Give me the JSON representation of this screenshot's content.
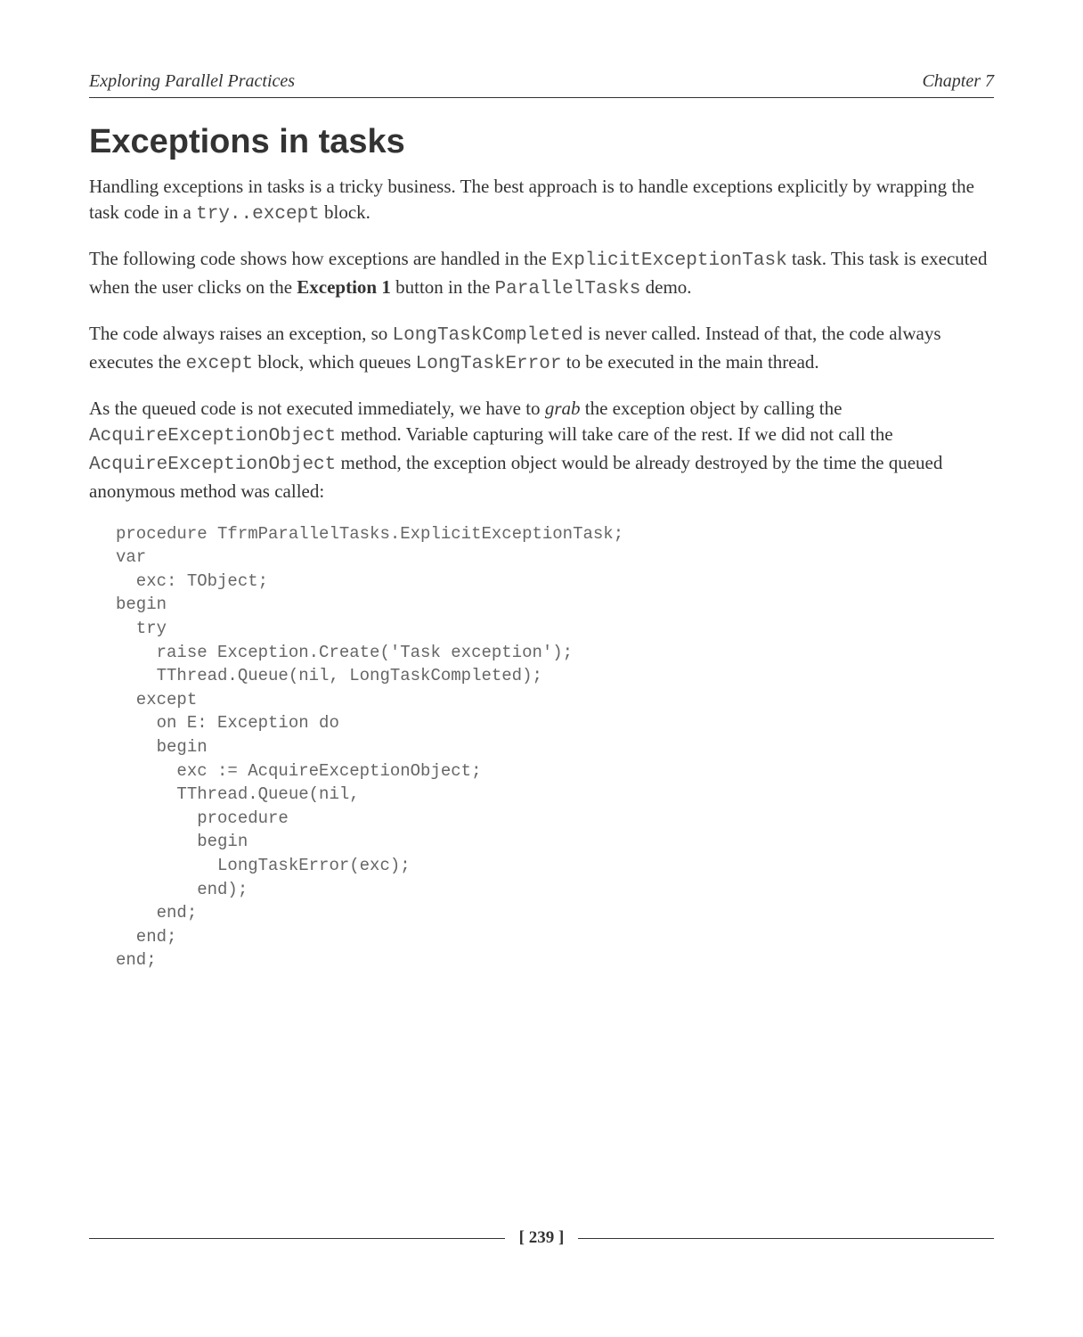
{
  "header": {
    "left": "Exploring Parallel Practices",
    "right": "Chapter 7"
  },
  "section_title": "Exceptions in tasks",
  "p1": {
    "t1": "Handling exceptions in tasks is a tricky business. The best approach is to handle exceptions explicitly by wrapping the task code in a ",
    "c1": "try..except",
    "t2": " block."
  },
  "p2": {
    "t1": "The following code shows how exceptions are handled in the ",
    "c1": "ExplicitExceptionTask",
    "t2": " task. This task is executed when the user clicks on the ",
    "b1": "Exception 1",
    "t3": " button in the ",
    "c2": "ParallelTasks",
    "t4": " demo."
  },
  "p3": {
    "t1": "The code always raises an exception, so ",
    "c1": "LongTaskCompleted",
    "t2": " is never called. Instead of that, the code always executes the ",
    "c2": "except",
    "t3": " block, which queues ",
    "c3": "LongTaskError",
    "t4": " to be executed in the main thread."
  },
  "p4": {
    "t1": "As the queued code is not executed immediately, we have to ",
    "i1": "grab",
    "t2": " the exception object by calling the ",
    "c1": "AcquireExceptionObject",
    "t3": " method. Variable capturing will take care of the rest. If we did not call the ",
    "c2": "AcquireExceptionObject",
    "t4": " method, the exception object would be already destroyed by the time the queued anonymous method was called:"
  },
  "code": "procedure TfrmParallelTasks.ExplicitExceptionTask;\nvar\n  exc: TObject;\nbegin\n  try\n    raise Exception.Create('Task exception');\n    TThread.Queue(nil, LongTaskCompleted);\n  except\n    on E: Exception do\n    begin\n      exc := AcquireExceptionObject;\n      TThread.Queue(nil,\n        procedure\n        begin\n          LongTaskError(exc);\n        end);\n    end;\n  end;\nend;",
  "footer": {
    "page": "[ 239 ]"
  }
}
